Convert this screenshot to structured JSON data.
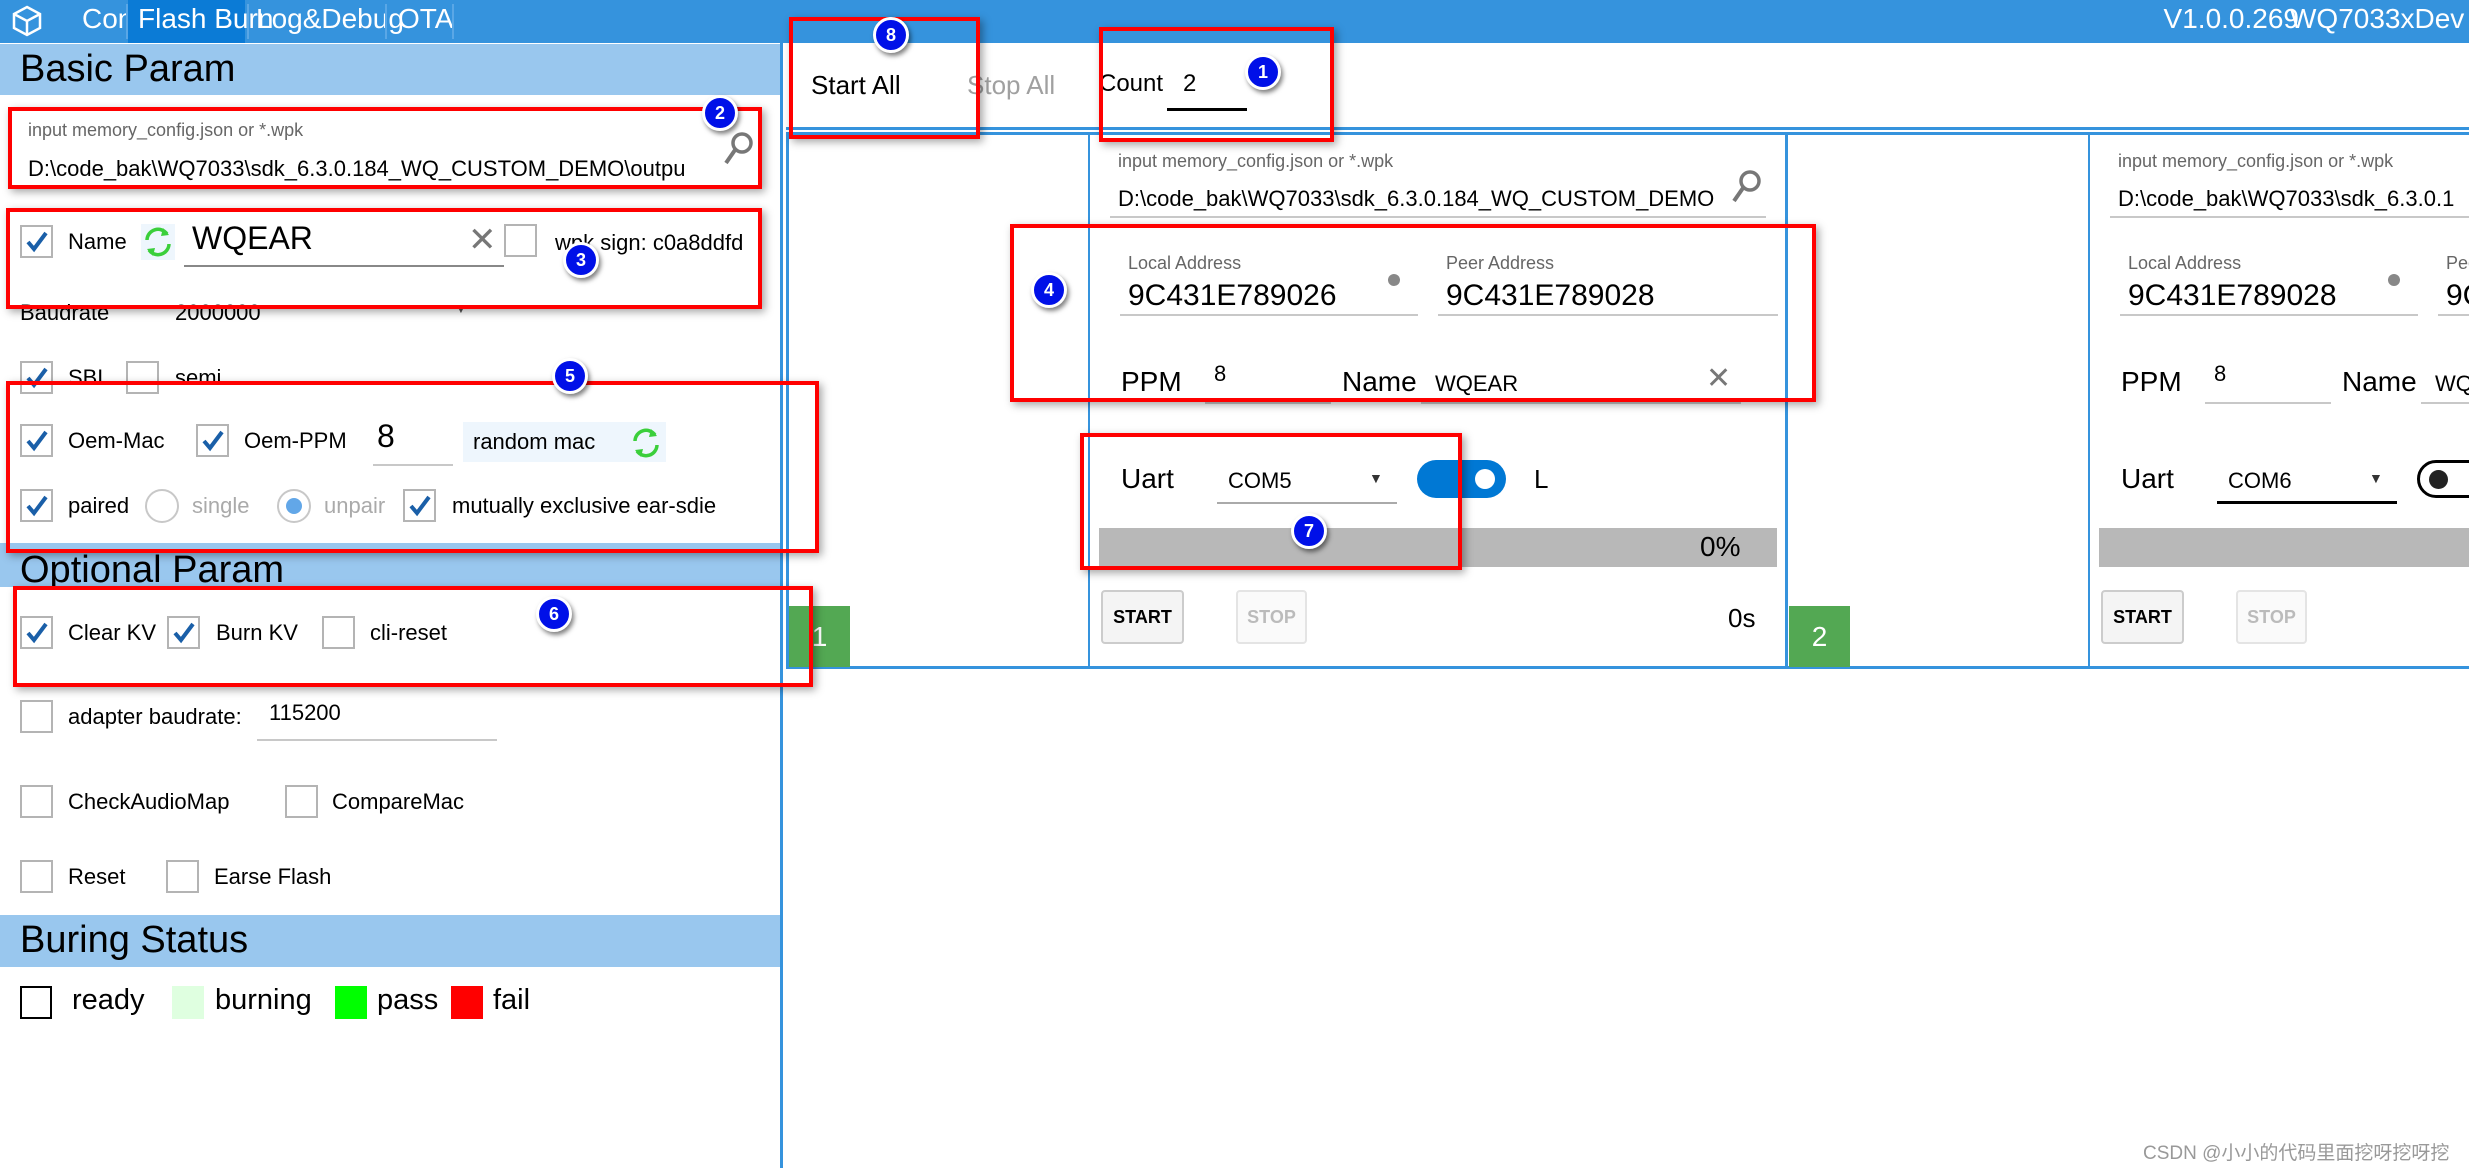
{
  "titlebar": {
    "tabs": [
      "Config",
      "Flash Burn",
      "Log&Debug",
      "OTA"
    ],
    "active_tab": "Flash Burn",
    "version": "V1.0.0.269",
    "app_name": "WQ7033xDev",
    "icon": "cube-icon"
  },
  "left": {
    "basic_title": "Basic Param",
    "file_input": {
      "label": "input memory_config.json or *.wpk",
      "value": "D:\\code_bak\\WQ7033\\sdk_6.3.0.184_WQ_CUSTOM_DEMO\\outpu"
    },
    "name": {
      "checked": true,
      "label": "Name",
      "value": "WQEAR"
    },
    "wpk_sign": {
      "checked": false,
      "label": "wpk sign: c0a8ddfd"
    },
    "baudrate": {
      "label": "Baudrate",
      "value": "2000000"
    },
    "sbl": {
      "label": "SBL",
      "checked": true
    },
    "semi": {
      "label": "semi",
      "checked": false
    },
    "oem_mac": {
      "label": "Oem-Mac",
      "checked": true
    },
    "oem_ppm": {
      "label": "Oem-PPM",
      "checked": true,
      "value": "8"
    },
    "random_mac": "random mac",
    "paired": {
      "label": "paired",
      "checked": true
    },
    "single": {
      "label": "single",
      "selected": false
    },
    "unpair": {
      "label": "unpair",
      "selected": true
    },
    "mutex": {
      "label": "mutually exclusive ear-sdie",
      "checked": true
    },
    "optional_title": "Optional Param",
    "clear_kv": {
      "label": "Clear KV",
      "checked": true
    },
    "burn_kv": {
      "label": "Burn KV",
      "checked": true
    },
    "cli_reset": {
      "label": "cli-reset",
      "checked": false
    },
    "adapter": {
      "label": "adapter baudrate:",
      "value": "115200",
      "checked": false
    },
    "check_audio": {
      "label": "CheckAudioMap",
      "checked": false
    },
    "compare_mac": {
      "label": "CompareMac",
      "checked": false
    },
    "reset": {
      "label": "Reset",
      "checked": false
    },
    "erase": {
      "label": "Earse Flash",
      "checked": false
    },
    "status_title": "Buring Status",
    "legend": [
      {
        "label": "ready",
        "color": "#ffffff"
      },
      {
        "label": "burning",
        "color": "#dfffe0"
      },
      {
        "label": "pass",
        "color": "#00ff00"
      },
      {
        "label": "fail",
        "color": "#ff0000"
      }
    ]
  },
  "toolbar": {
    "start_all": "Start All",
    "stop_all": "Stop All",
    "count_label": "Count",
    "count_value": "2"
  },
  "devices": [
    {
      "index": "1",
      "file_label": "input memory_config.json or *.wpk",
      "file_value": "D:\\code_bak\\WQ7033\\sdk_6.3.0.184_WQ_CUSTOM_DEMO",
      "local_label": "Local Address",
      "local": "9C431E789026",
      "peer_label": "Peer Address",
      "peer": "9C431E789028",
      "ppm_label": "PPM",
      "ppm": "8",
      "name_label": "Name",
      "name": "WQEAR",
      "uart_label": "Uart",
      "uart": "COM5",
      "toggle_on": true,
      "side": "L",
      "progress": "0%",
      "progress_value": 0,
      "start": "START",
      "stop": "STOP",
      "time": "0s"
    },
    {
      "index": "2",
      "file_label": "input memory_config.json or *.wpk",
      "file_value": "D:\\code_bak\\WQ7033\\sdk_6.3.0.1",
      "local_label": "Local Address",
      "local": "9C431E789028",
      "peer_label": "Peer Address",
      "peer": "9C",
      "ppm_label": "PPM",
      "ppm": "8",
      "name_label": "Name",
      "name": "WQ",
      "uart_label": "Uart",
      "uart": "COM6",
      "toggle_on": false,
      "start": "START",
      "stop": "STOP"
    }
  ],
  "annotations": [
    "1",
    "2",
    "3",
    "4",
    "5",
    "6",
    "7",
    "8"
  ],
  "watermark": "CSDN @小小的代码里面挖呀挖呀挖",
  "colors": {
    "accent": "#3593dd",
    "active_tab": "#0b7bd6",
    "band": "#99c7ee",
    "toggle": "#0078d4",
    "badge": "#53a853"
  }
}
